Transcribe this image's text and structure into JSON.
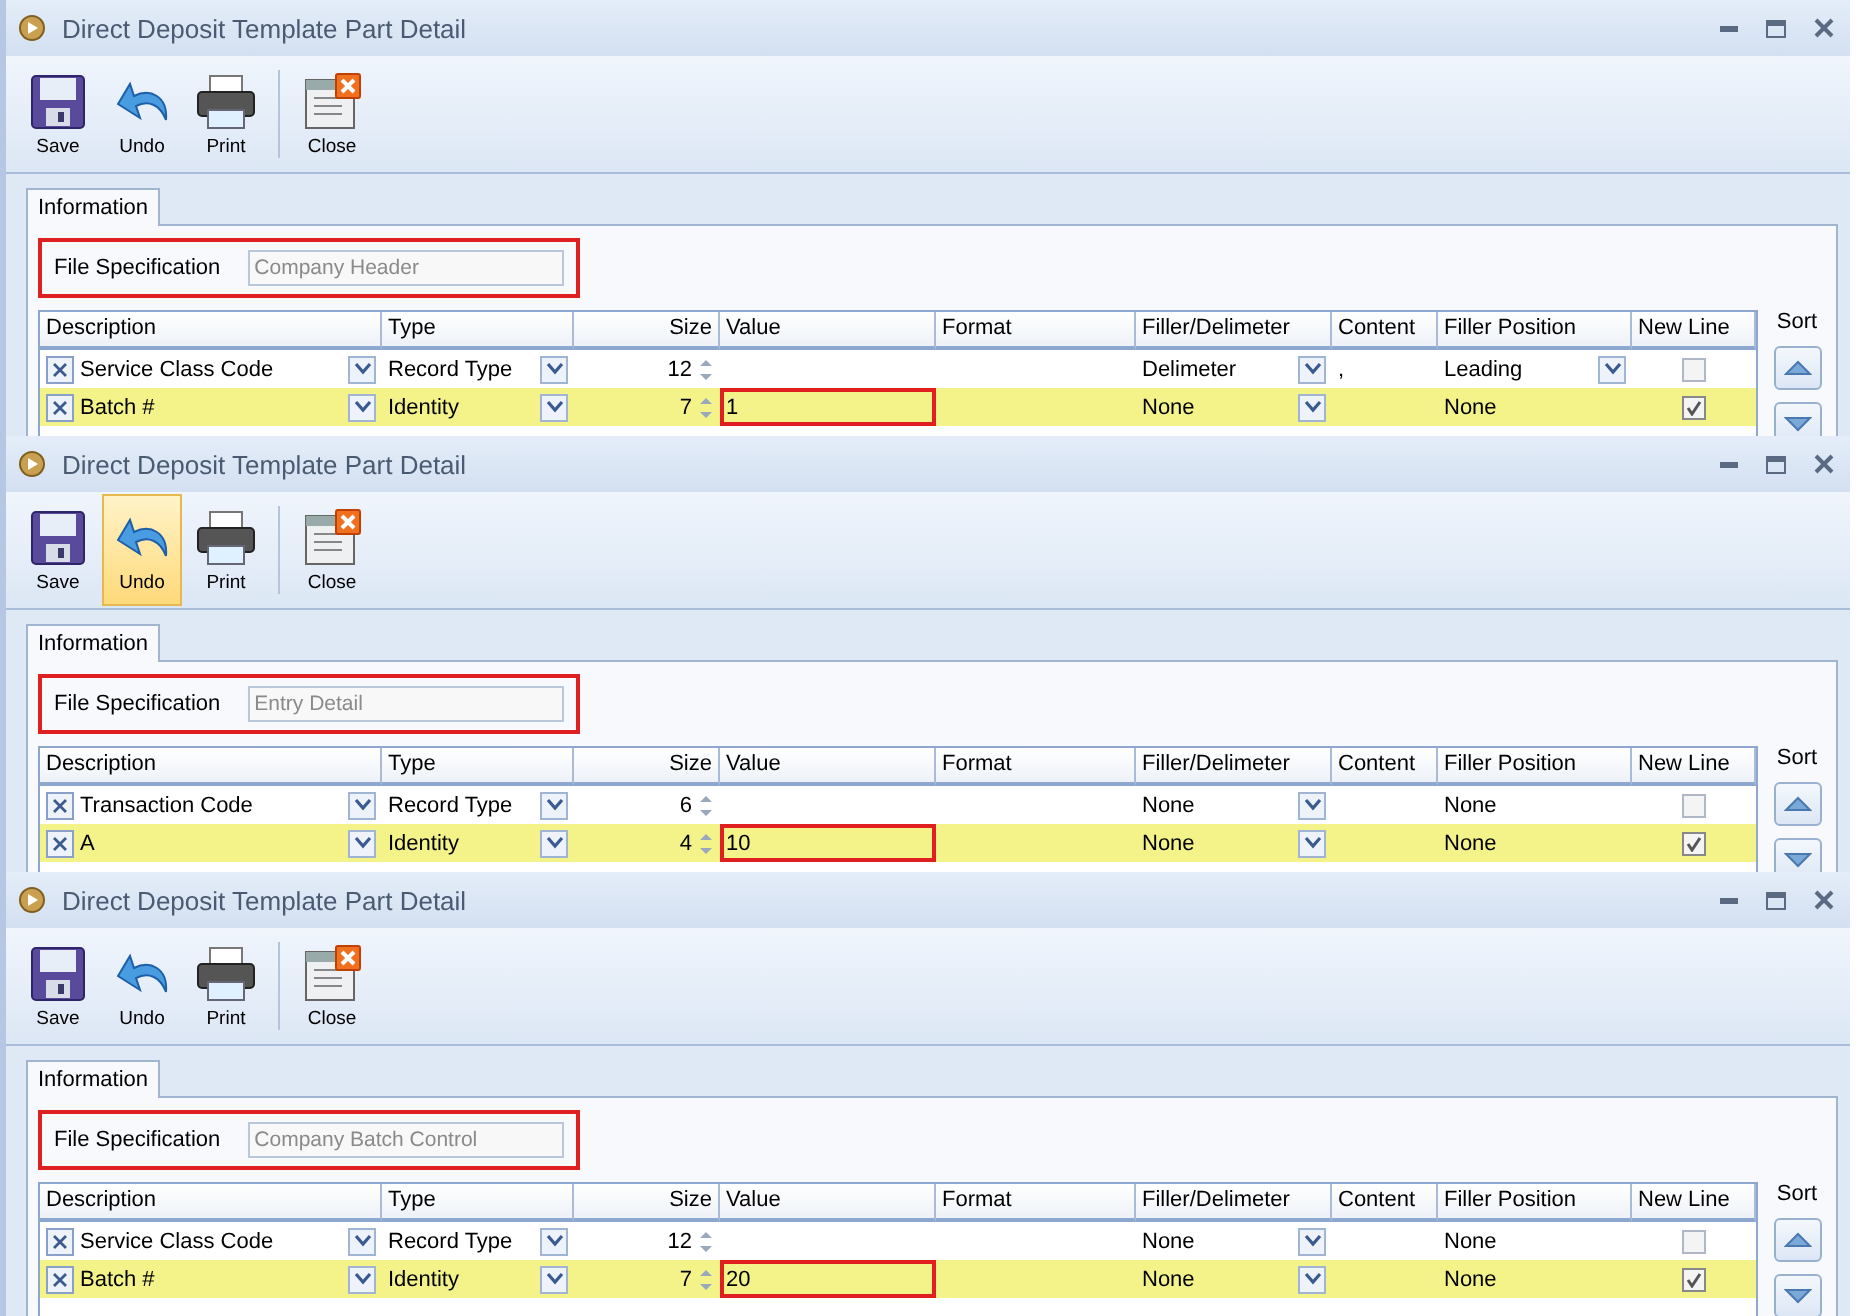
{
  "windows": [
    {
      "title": "Direct Deposit Template Part Detail",
      "toolbar": [
        {
          "kind": "save",
          "label": "Save",
          "highlighted": false
        },
        {
          "kind": "undo",
          "label": "Undo",
          "highlighted": false
        },
        {
          "kind": "print",
          "label": "Print",
          "highlighted": false
        },
        {
          "kind": "close",
          "label": "Close",
          "highlighted": false
        }
      ],
      "tabs": [
        {
          "label": "Information",
          "selected": true
        }
      ],
      "file_spec": {
        "label": "File Specification",
        "value": "Company Header",
        "disabled": true,
        "annotated": true
      },
      "columns": [
        "Description",
        "Type",
        "Size",
        "Value",
        "Format",
        "Filler/Delimeter",
        "Content",
        "Filler Position",
        "New Line"
      ],
      "rows": [
        {
          "description": "Service Class Code",
          "type": "Record Type",
          "size": "12",
          "value": "",
          "value_annotated": false,
          "format": "",
          "filler": "Delimeter",
          "content": ",",
          "filler_position": "Leading",
          "filler_position_dropdown": true,
          "new_line": false,
          "selected": false
        },
        {
          "description": "Batch #",
          "type": "Identity",
          "size": "7",
          "value": "1",
          "value_annotated": true,
          "format": "",
          "filler": "None",
          "content": "",
          "filler_position": "None",
          "filler_position_dropdown": false,
          "new_line": true,
          "selected": true
        }
      ],
      "sort_label": "Sort"
    },
    {
      "title": "Direct Deposit Template Part Detail",
      "toolbar": [
        {
          "kind": "save",
          "label": "Save",
          "highlighted": false
        },
        {
          "kind": "undo",
          "label": "Undo",
          "highlighted": true
        },
        {
          "kind": "print",
          "label": "Print",
          "highlighted": false
        },
        {
          "kind": "close",
          "label": "Close",
          "highlighted": false
        }
      ],
      "tabs": [
        {
          "label": "Information",
          "selected": true
        }
      ],
      "file_spec": {
        "label": "File Specification",
        "value": "Entry Detail",
        "disabled": true,
        "annotated": true
      },
      "columns": [
        "Description",
        "Type",
        "Size",
        "Value",
        "Format",
        "Filler/Delimeter",
        "Content",
        "Filler Position",
        "New Line"
      ],
      "rows": [
        {
          "description": "Transaction Code",
          "type": "Record Type",
          "size": "6",
          "value": "",
          "value_annotated": false,
          "format": "",
          "filler": "None",
          "content": "",
          "filler_position": "None",
          "filler_position_dropdown": false,
          "new_line": false,
          "selected": false
        },
        {
          "description": "A",
          "type": "Identity",
          "size": "4",
          "value": "10",
          "value_annotated": true,
          "format": "",
          "filler": "None",
          "content": "",
          "filler_position": "None",
          "filler_position_dropdown": false,
          "new_line": true,
          "selected": true
        }
      ],
      "sort_label": "Sort"
    },
    {
      "title": "Direct Deposit Template Part Detail",
      "toolbar": [
        {
          "kind": "save",
          "label": "Save",
          "highlighted": false
        },
        {
          "kind": "undo",
          "label": "Undo",
          "highlighted": false
        },
        {
          "kind": "print",
          "label": "Print",
          "highlighted": false
        },
        {
          "kind": "close",
          "label": "Close",
          "highlighted": false
        }
      ],
      "tabs": [
        {
          "label": "Information",
          "selected": true
        }
      ],
      "file_spec": {
        "label": "File Specification",
        "value": "Company Batch Control",
        "disabled": true,
        "annotated": true
      },
      "columns": [
        "Description",
        "Type",
        "Size",
        "Value",
        "Format",
        "Filler/Delimeter",
        "Content",
        "Filler Position",
        "New Line"
      ],
      "rows": [
        {
          "description": "Service Class Code",
          "type": "Record Type",
          "size": "12",
          "value": "",
          "value_annotated": false,
          "format": "",
          "filler": "None",
          "content": "",
          "filler_position": "None",
          "filler_position_dropdown": false,
          "new_line": false,
          "selected": false
        },
        {
          "description": "Batch #",
          "type": "Identity",
          "size": "7",
          "value": "20",
          "value_annotated": true,
          "format": "",
          "filler": "None",
          "content": "",
          "filler_position": "None",
          "filler_position_dropdown": false,
          "new_line": true,
          "selected": true
        }
      ],
      "sort_label": "Sort"
    }
  ]
}
